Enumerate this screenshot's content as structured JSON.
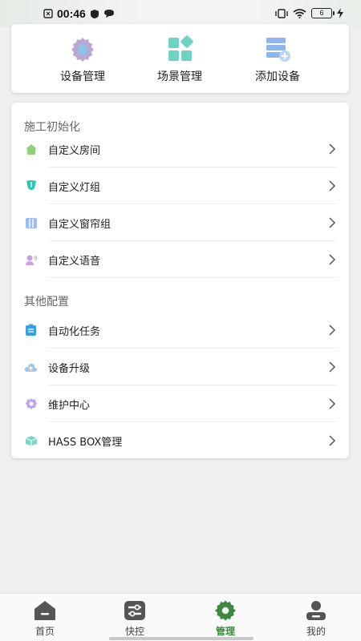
{
  "status_bar": {
    "time": "00:46",
    "battery": "6"
  },
  "top_actions": [
    {
      "label": "设备管理",
      "icon": "gear-icon"
    },
    {
      "label": "场景管理",
      "icon": "scene-grid-icon"
    },
    {
      "label": "添加设备",
      "icon": "add-server-icon"
    }
  ],
  "sections": [
    {
      "title": "施工初始化",
      "items": [
        {
          "label": "自定义房间",
          "icon": "house-icon"
        },
        {
          "label": "自定义灯组",
          "icon": "light-icon"
        },
        {
          "label": "自定义窗帘组",
          "icon": "curtain-icon"
        },
        {
          "label": "自定义语音",
          "icon": "voice-icon"
        }
      ]
    },
    {
      "title": "其他配置",
      "items": [
        {
          "label": "自动化任务",
          "icon": "task-icon"
        },
        {
          "label": "设备升级",
          "icon": "cloud-upload-icon"
        },
        {
          "label": "维护中心",
          "icon": "maintenance-icon"
        },
        {
          "label": "HASS BOX管理",
          "icon": "box-icon"
        }
      ]
    }
  ],
  "bottom_nav": [
    {
      "label": "首页",
      "icon": "home-icon"
    },
    {
      "label": "快控",
      "icon": "quick-control-icon"
    },
    {
      "label": "管理",
      "icon": "manage-gear-icon",
      "active": true
    },
    {
      "label": "我的",
      "icon": "profile-icon"
    }
  ],
  "colors": {
    "accent": "#3d8a3f",
    "background": "#efefef",
    "card": "#ffffff"
  }
}
